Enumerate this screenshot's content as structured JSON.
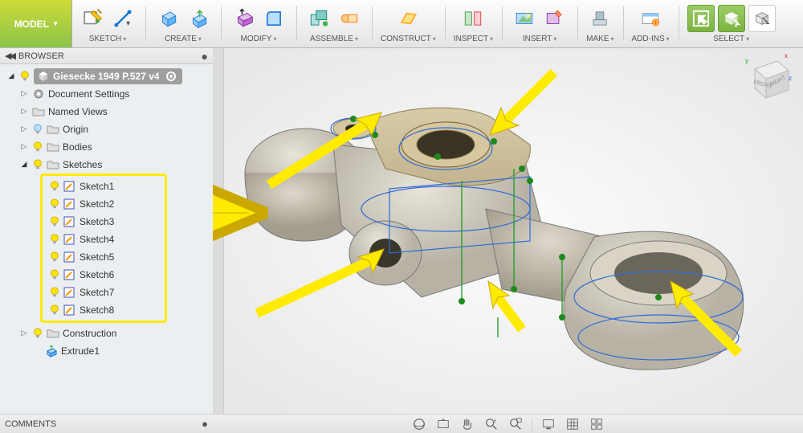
{
  "app_mode": "MODEL",
  "toolbar": {
    "groups": [
      {
        "label": "SKETCH"
      },
      {
        "label": "CREATE"
      },
      {
        "label": "MODIFY"
      },
      {
        "label": "ASSEMBLE"
      },
      {
        "label": "CONSTRUCT"
      },
      {
        "label": "INSPECT"
      },
      {
        "label": "INSERT"
      },
      {
        "label": "MAKE"
      },
      {
        "label": "ADD-INS"
      },
      {
        "label": "SELECT"
      }
    ]
  },
  "browser": {
    "panel_title": "BROWSER",
    "doc_title": "Giesecke 1949 P.527 v4",
    "nodes": {
      "doc_settings": "Document Settings",
      "named_views": "Named Views",
      "origin": "Origin",
      "bodies": "Bodies",
      "sketches": "Sketches",
      "construction": "Construction",
      "extrude1": "Extrude1"
    },
    "sketches": [
      "Sketch1",
      "Sketch2",
      "Sketch3",
      "Sketch4",
      "Sketch5",
      "Sketch6",
      "Sketch7",
      "Sketch8"
    ]
  },
  "viewcube": {
    "front": "FRONT",
    "right": "RIGHT",
    "axes": {
      "x": "x",
      "y": "y",
      "z": "z"
    }
  },
  "comments_label": "COMMENTS"
}
